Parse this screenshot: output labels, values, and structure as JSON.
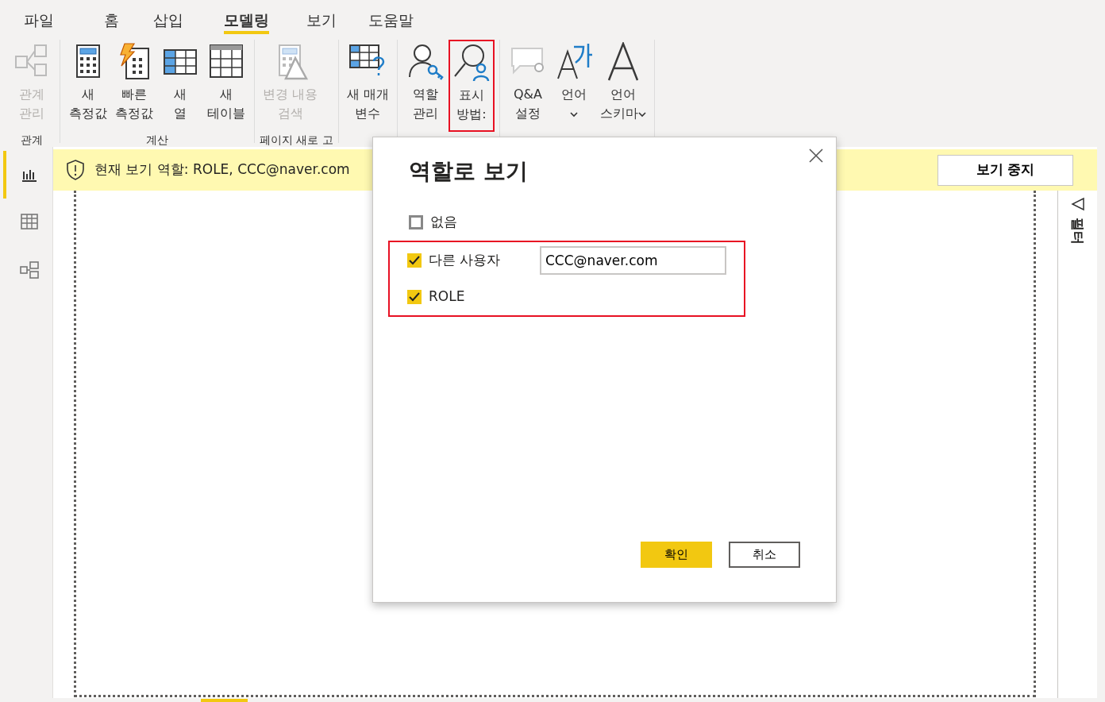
{
  "menu_tabs": [
    {
      "label": "파일",
      "selected": false
    },
    {
      "label": "홈",
      "selected": false
    },
    {
      "label": "삽입",
      "selected": false
    },
    {
      "label": "모델링",
      "selected": true
    },
    {
      "label": "보기",
      "selected": false
    },
    {
      "label": "도움말",
      "selected": false
    }
  ],
  "ribbon_groups": [
    {
      "label": "관계",
      "buttons": [
        {
          "lines": [
            "관계",
            "관리"
          ],
          "disabled": true,
          "highlighted": false,
          "dropdown": false
        }
      ]
    },
    {
      "label": "계산",
      "buttons": [
        {
          "lines": [
            "새",
            "측정값"
          ],
          "disabled": false,
          "highlighted": false,
          "dropdown": false
        },
        {
          "lines": [
            "빠른",
            "측정값"
          ],
          "disabled": false,
          "highlighted": false,
          "dropdown": false
        },
        {
          "lines": [
            "새",
            "열"
          ],
          "disabled": false,
          "highlighted": false,
          "dropdown": false
        },
        {
          "lines": [
            "새",
            "테이블"
          ],
          "disabled": false,
          "highlighted": false,
          "dropdown": false
        }
      ]
    },
    {
      "label": "페이지 새로 고",
      "buttons": [
        {
          "lines": [
            "변경 내용",
            "검색"
          ],
          "disabled": true,
          "highlighted": false,
          "dropdown": false
        }
      ]
    },
    {
      "buttons": [
        {
          "lines": [
            "새 매개",
            "변수"
          ],
          "disabled": false,
          "highlighted": false,
          "dropdown": false
        }
      ]
    },
    {
      "buttons": [
        {
          "lines": [
            "역할",
            "관리"
          ],
          "disabled": false,
          "highlighted": false,
          "dropdown": false
        },
        {
          "lines": [
            "표시",
            "방법:"
          ],
          "disabled": false,
          "highlighted": true,
          "dropdown": false
        }
      ]
    },
    {
      "buttons": [
        {
          "lines": [
            "Q&A",
            "설정"
          ],
          "disabled": false,
          "highlighted": false,
          "dropdown": false
        },
        {
          "lines": [
            "언어"
          ],
          "disabled": false,
          "highlighted": false,
          "dropdown": true
        },
        {
          "lines": [
            "언어",
            "스키마"
          ],
          "disabled": false,
          "highlighted": false,
          "dropdown": true
        }
      ]
    }
  ],
  "view_switcher": [
    {
      "selected": true
    },
    {
      "selected": false
    },
    {
      "selected": false
    }
  ],
  "banner": {
    "text": "현재 보기 역할: ROLE, CCC@naver.com",
    "button": "보기 중지"
  },
  "filter_pane": {
    "label": "필터"
  },
  "dialog": {
    "title": "역할로 보기",
    "options": [
      {
        "label": "없음",
        "checked": false,
        "highlighted": false
      },
      {
        "label": "다른 사용자",
        "checked": true,
        "highlighted": true,
        "value": "CCC@naver.com"
      },
      {
        "label": "ROLE",
        "checked": true,
        "highlighted": true
      }
    ],
    "buttons": [
      {
        "label": "확인",
        "primary": true
      },
      {
        "label": "취소",
        "primary": false
      }
    ]
  }
}
